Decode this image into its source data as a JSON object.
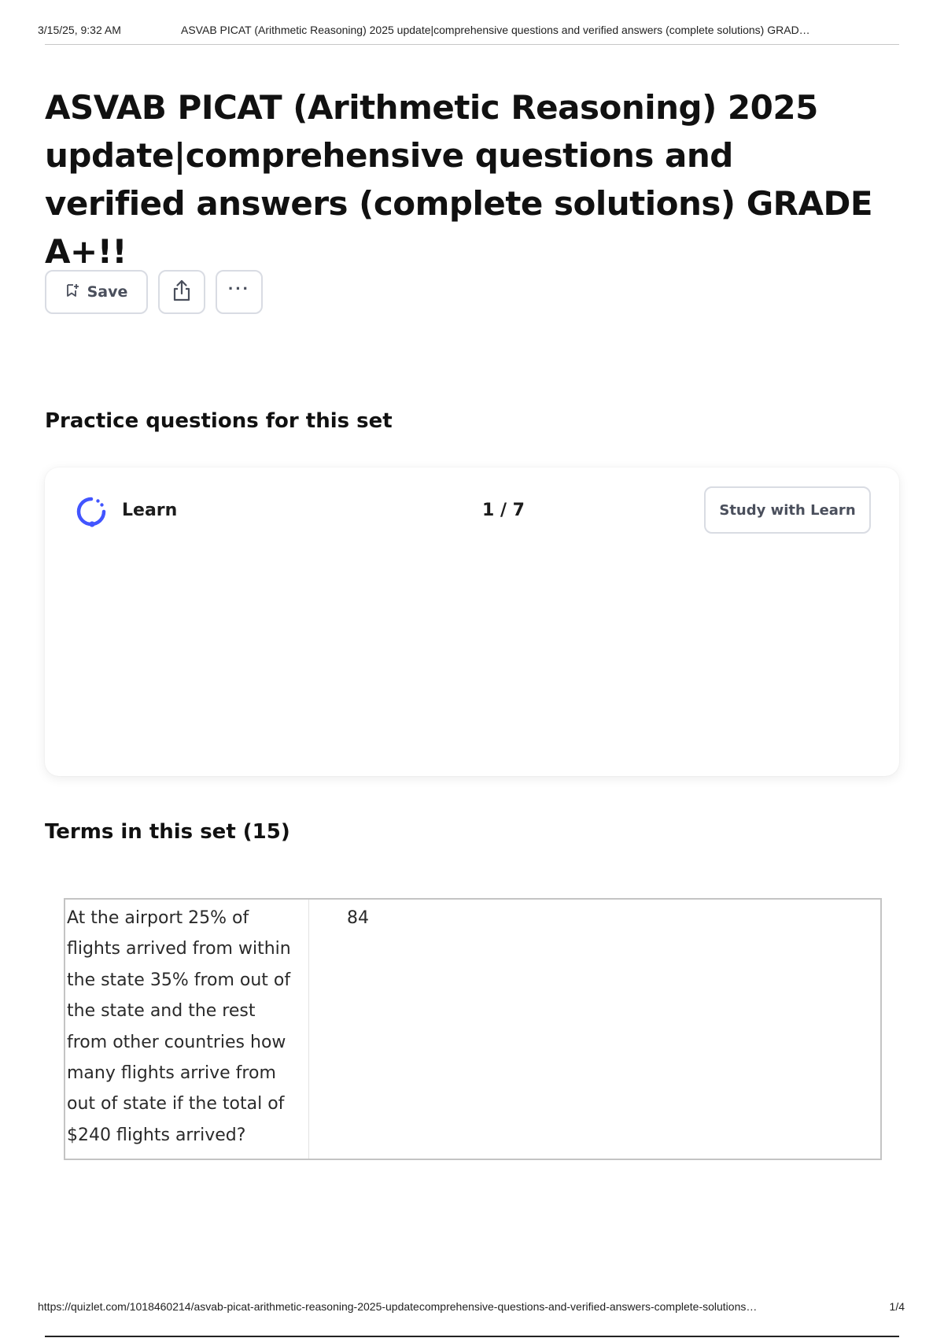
{
  "print_header": {
    "date": "3/15/25, 9:32 AM",
    "title": "ASVAB PICAT (Arithmetic Reasoning) 2025 update|comprehensive questions and verified answers (complete solutions) GRAD…"
  },
  "page": {
    "title": "ASVAB PICAT (Arithmetic Reasoning) 2025 update|comprehensive questions and verified answers (complete solutions) GRADE A+!!"
  },
  "toolbar": {
    "save_label": "Save",
    "save_icon": "bookmark-add-icon",
    "share_icon": "share-icon",
    "more_icon": "more-horizontal-icon",
    "more_label": "···"
  },
  "practice": {
    "heading": "Practice questions for this set",
    "learn_label": "Learn",
    "learn_icon": "learn-progress-icon",
    "progress": "1 / 7",
    "study_button_label": "Study with Learn",
    "accent_color": "#4255ff"
  },
  "terms": {
    "heading": "Terms in this set (15)",
    "items": [
      {
        "term_lines": [
          "At the airport 25% of",
          "flights arrived from within",
          "the state 35% from out of",
          "the state and the rest",
          "from other countries how",
          "many flights arrive from",
          "out of state if the total of",
          "$240 flights arrived?"
        ],
        "definition": "84"
      }
    ]
  },
  "print_footer": {
    "url": "https://quizlet.com/1018460214/asvab-picat-arithmetic-reasoning-2025-updatecomprehensive-questions-and-verified-answers-complete-solutions…",
    "page": "1/4"
  }
}
